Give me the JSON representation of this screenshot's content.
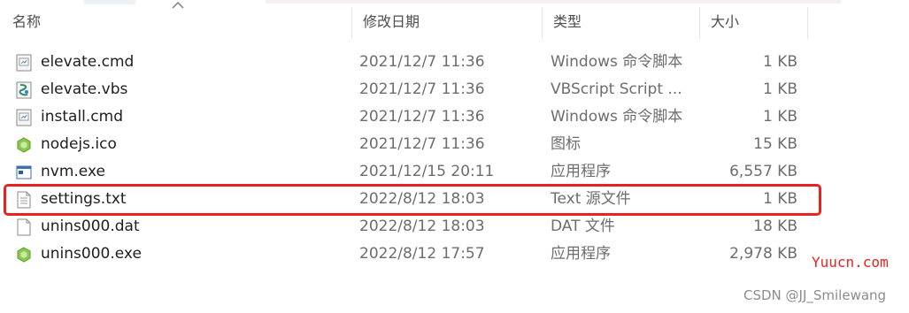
{
  "header": {
    "name_label": "名称",
    "date_label": "修改日期",
    "type_label": "类型",
    "size_label": "大小"
  },
  "files": [
    {
      "name": "elevate.cmd",
      "date": "2021/12/7 11:36",
      "type": "Windows 命令脚本",
      "size": "1 KB",
      "icon": "cmd-script-icon"
    },
    {
      "name": "elevate.vbs",
      "date": "2021/12/7 11:36",
      "type": "VBScript Script ...",
      "size": "1 KB",
      "icon": "vbs-script-icon"
    },
    {
      "name": "install.cmd",
      "date": "2021/12/7 11:36",
      "type": "Windows 命令脚本",
      "size": "1 KB",
      "icon": "cmd-script-icon"
    },
    {
      "name": "nodejs.ico",
      "date": "2021/12/7 11:36",
      "type": "图标",
      "size": "15 KB",
      "icon": "nodejs-icon"
    },
    {
      "name": "nvm.exe",
      "date": "2021/12/15 20:11",
      "type": "应用程序",
      "size": "6,557 KB",
      "icon": "exe-app-icon"
    },
    {
      "name": "settings.txt",
      "date": "2022/8/12 18:03",
      "type": "Text 源文件",
      "size": "1 KB",
      "icon": "text-file-icon"
    },
    {
      "name": "unins000.dat",
      "date": "2022/8/12 18:03",
      "type": "DAT 文件",
      "size": "18 KB",
      "icon": "blank-file-icon"
    },
    {
      "name": "unins000.exe",
      "date": "2022/8/12 17:57",
      "type": "应用程序",
      "size": "2,978 KB",
      "icon": "nodejs-icon"
    }
  ],
  "highlight": {
    "color": "#e8231f",
    "file": "settings.txt"
  },
  "watermarks": {
    "site": "Yuucn.com",
    "author": "CSDN @JJ_Smilewang"
  }
}
